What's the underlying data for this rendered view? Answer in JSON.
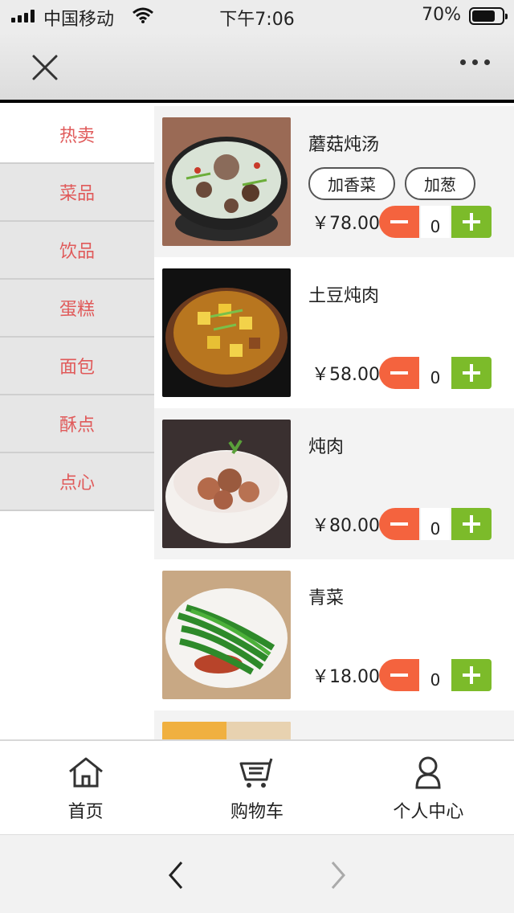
{
  "status": {
    "carrier": "中国移动",
    "time": "下午7:06",
    "battery": "70%",
    "battery_level": 0.7
  },
  "header": {
    "close_icon": "close-icon",
    "more_icon": "more-dots-icon"
  },
  "sidebar": {
    "items": [
      {
        "label": "热卖"
      },
      {
        "label": "菜品"
      },
      {
        "label": "饮品"
      },
      {
        "label": "蛋糕"
      },
      {
        "label": "面包"
      },
      {
        "label": "酥点"
      },
      {
        "label": "点心"
      }
    ]
  },
  "menu": {
    "items": [
      {
        "name": "蘑菇炖汤",
        "price": "￥78.00",
        "qty": "0",
        "options": [
          "加香菜",
          "加葱"
        ]
      },
      {
        "name": "土豆炖肉",
        "price": "￥58.00",
        "qty": "0"
      },
      {
        "name": "炖肉",
        "price": "￥80.00",
        "qty": "0"
      },
      {
        "name": "青菜",
        "price": "￥18.00",
        "qty": "0"
      },
      {
        "name": "",
        "price": "",
        "qty": ""
      }
    ]
  },
  "tabbar": {
    "items": [
      {
        "label": "首页",
        "icon": "home-icon"
      },
      {
        "label": "购物车",
        "icon": "cart-icon"
      },
      {
        "label": "个人中心",
        "icon": "user-icon"
      }
    ]
  },
  "browser": {
    "back_icon": "chevron-left-icon",
    "forward_icon": "chevron-right-icon"
  }
}
